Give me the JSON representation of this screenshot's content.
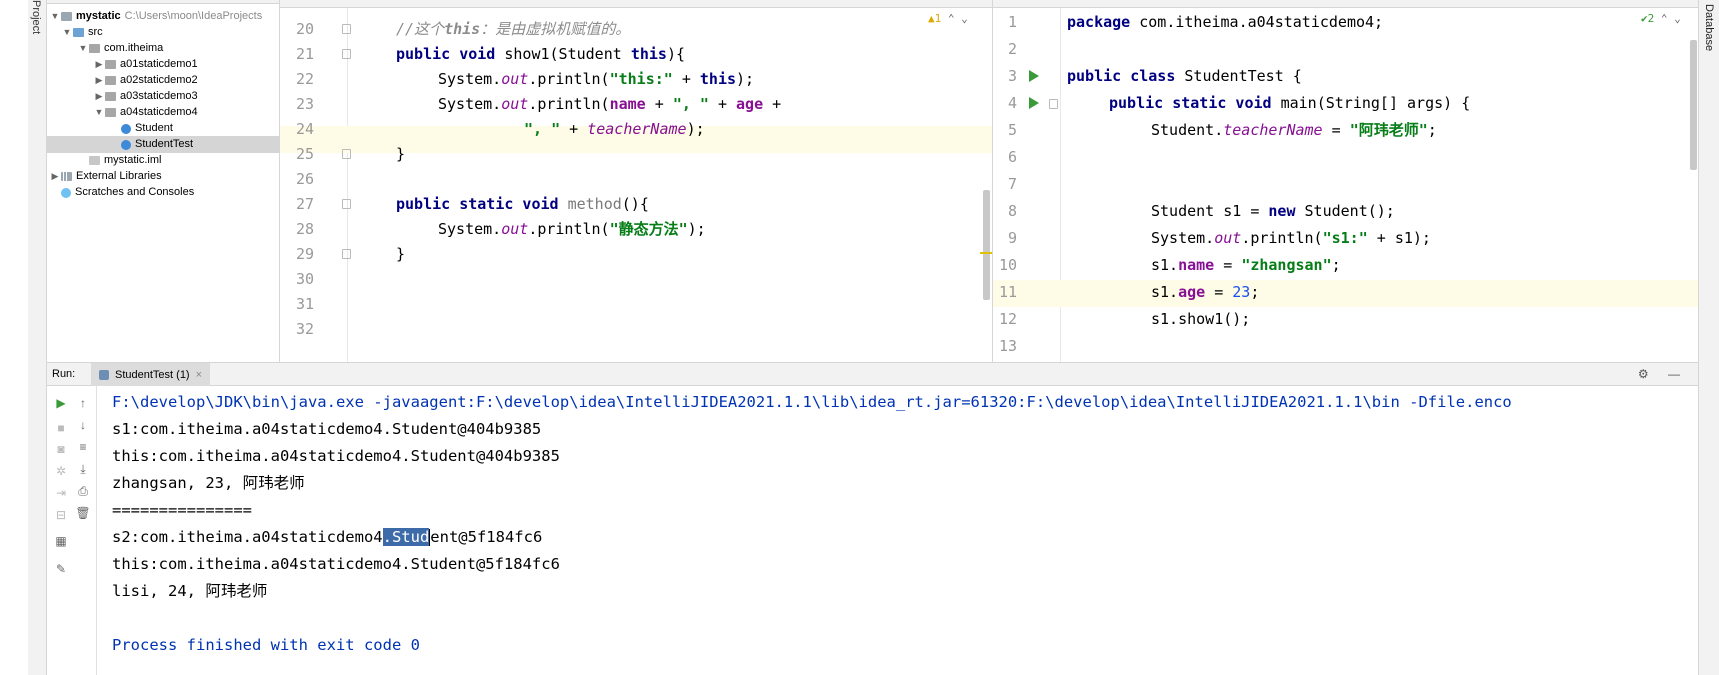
{
  "sidebar": {
    "project_tab": "Project",
    "database_tab": "Database"
  },
  "tree": {
    "root": {
      "label": "mystatic",
      "path": "C:\\Users\\moon\\IdeaProjects"
    },
    "items": [
      {
        "label": "src"
      },
      {
        "label": "com.itheima"
      },
      {
        "label": "a01staticdemo1"
      },
      {
        "label": "a02staticdemo2"
      },
      {
        "label": "a03staticdemo3"
      },
      {
        "label": "a04staticdemo4"
      },
      {
        "label": "Student"
      },
      {
        "label": "StudentTest"
      },
      {
        "label": "mystatic.iml"
      },
      {
        "label": "External Libraries"
      },
      {
        "label": "Scratches and Consoles"
      }
    ]
  },
  "editor_left": {
    "warning_badge": "▲1",
    "line_numbers": [
      "20",
      "21",
      "22",
      "23",
      "24",
      "25",
      "26",
      "27",
      "28",
      "29",
      "30",
      "31",
      "32"
    ],
    "lines": {
      "l20_comment": "//这个",
      "l20_this": "this",
      "l20_rest": "：是由虚拟机赋值的。",
      "l21_kw": "public void",
      "l21_sig": " show1(Student ",
      "l21_this": "this",
      "l21_end": "){",
      "l22_a": "System.",
      "l22_out": "out",
      "l22_b": ".println(",
      "l22_str": "\"this:\"",
      "l22_c": " + ",
      "l22_this": "this",
      "l22_d": ");",
      "l23_a": "System.",
      "l23_out": "out",
      "l23_b": ".println(",
      "l23_name": "name",
      "l23_c": " + ",
      "l23_str": "\", \"",
      "l23_d": " + ",
      "l23_age": "age",
      "l23_e": " +",
      "l24_str": "\", \"",
      "l24_a": " + ",
      "l24_tn": "teacherName",
      "l24_b": ");",
      "l25": "}",
      "l27_kw": "public static void",
      "l27_m": " method",
      "l27_end": "(){",
      "l28_a": "System.",
      "l28_out": "out",
      "l28_b": ".println(",
      "l28_str": "\"静态方法\"",
      "l28_c": ");",
      "l29": "}"
    }
  },
  "editor_right": {
    "check_badge": "✔2",
    "line_numbers": [
      "1",
      "2",
      "3",
      "4",
      "5",
      "6",
      "7",
      "8",
      "9",
      "10",
      "11",
      "12",
      "13"
    ],
    "lines": {
      "l1_kw": "package",
      "l1_rest": " com.itheima.a04staticdemo4;",
      "l3_kw": "public class",
      "l3_rest": " StudentTest {",
      "l4_kw": "public static void",
      "l4_rest": " main(String[] args) {",
      "l5_a": "Student.",
      "l5_tn": "teacherName",
      "l5_b": " = ",
      "l5_str": "\"阿玮老师\"",
      "l5_c": ";",
      "l8_a": "Student s1 = ",
      "l8_kw": "new",
      "l8_b": " Student();",
      "l9_a": "System.",
      "l9_out": "out",
      "l9_b": ".println(",
      "l9_str": "\"s1:\"",
      "l9_c": " + s1);",
      "l10_a": "s1.",
      "l10_fld": "name",
      "l10_b": " = ",
      "l10_str": "\"zhangsan\"",
      "l10_c": ";",
      "l11_a": "s1.",
      "l11_fld": "age",
      "l11_b": " = ",
      "l11_num": "23",
      "l11_c": ";",
      "l12": "s1.show1();"
    }
  },
  "run": {
    "label": "Run:",
    "tab": "StudentTest (1)",
    "tab_close": "×",
    "header_icons": "⚙ —",
    "output": {
      "cmd": "F:\\develop\\JDK\\bin\\java.exe -javaagent:F:\\develop\\idea\\IntelliJIDEA2021.1.1\\lib\\idea_rt.jar=61320:F:\\develop\\idea\\IntelliJIDEA2021.1.1\\bin -Dfile.enco",
      "l1": "s1:com.itheima.a04staticdemo4.Student@404b9385",
      "l2": "this:com.itheima.a04staticdemo4.Student@404b9385",
      "l3": "zhangsan, 23, 阿玮老师",
      "l4": "===============",
      "l5_a": "s2:com.itheima.a04staticdemo4",
      "l5_sel": ".Stud",
      "l5_b": "ent@5f184fc6",
      "l6": "this:com.itheima.a04staticdemo4.Student@5f184fc6",
      "l7": "lisi, 24, 阿玮老师",
      "l8": "Process finished with exit code 0"
    }
  }
}
